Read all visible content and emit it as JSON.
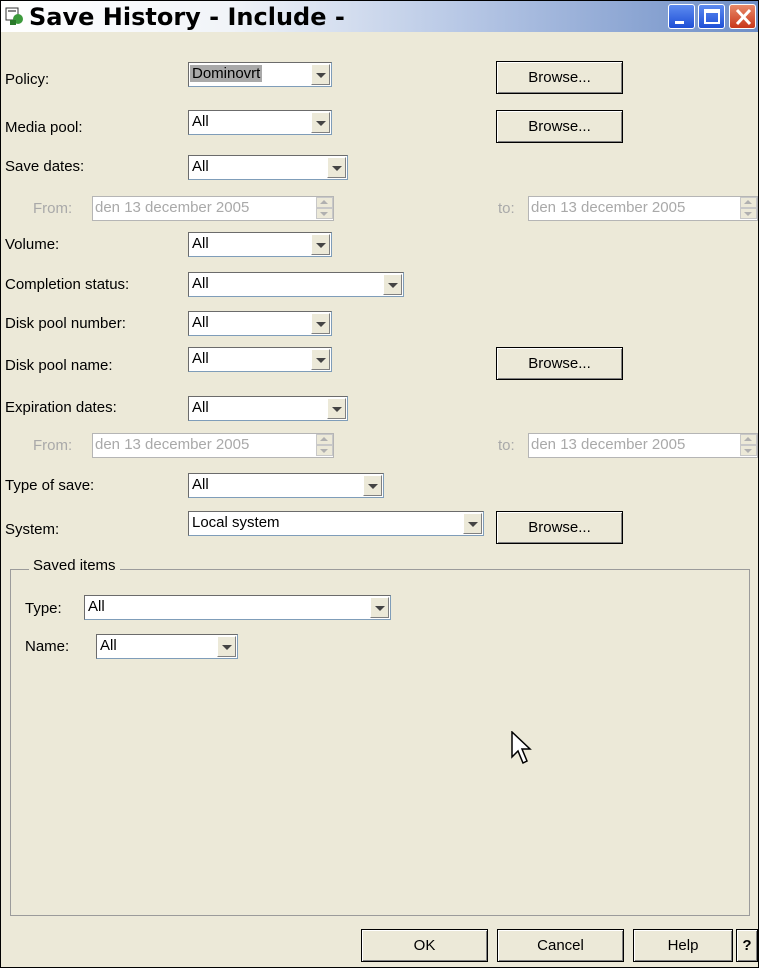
{
  "window": {
    "title": "Save History - Include -"
  },
  "fields": {
    "policy": {
      "label": "Policy:",
      "value": "Dominovrt",
      "browse": "Browse..."
    },
    "media_pool": {
      "label": "Media pool:",
      "value": "All",
      "browse": "Browse..."
    },
    "save_dates": {
      "label": "Save dates:",
      "value": "All",
      "from_label": "From:",
      "from_value": "den 13 december 2005",
      "to_label": "to:",
      "to_value": "den 13 december 2005"
    },
    "volume": {
      "label": "Volume:",
      "value": "All"
    },
    "completion_status": {
      "label": "Completion status:",
      "value": "All"
    },
    "disk_pool_number": {
      "label": "Disk pool number:",
      "value": "All"
    },
    "disk_pool_name": {
      "label": "Disk pool name:",
      "value": "All",
      "browse": "Browse..."
    },
    "expiration_dates": {
      "label": "Expiration dates:",
      "value": "All",
      "from_label": "From:",
      "from_value": "den 13 december 2005",
      "to_label": "to:",
      "to_value": "den 13 december 2005"
    },
    "type_of_save": {
      "label": "Type of save:",
      "value": "All"
    },
    "system": {
      "label": "System:",
      "value": "Local system",
      "browse": "Browse..."
    }
  },
  "saved_items": {
    "title": "Saved items",
    "type_label": "Type:",
    "type_value": "All",
    "name_label": "Name:",
    "name_value": "All"
  },
  "footer": {
    "ok": "OK",
    "cancel": "Cancel",
    "help": "Help",
    "context_help": "?"
  }
}
